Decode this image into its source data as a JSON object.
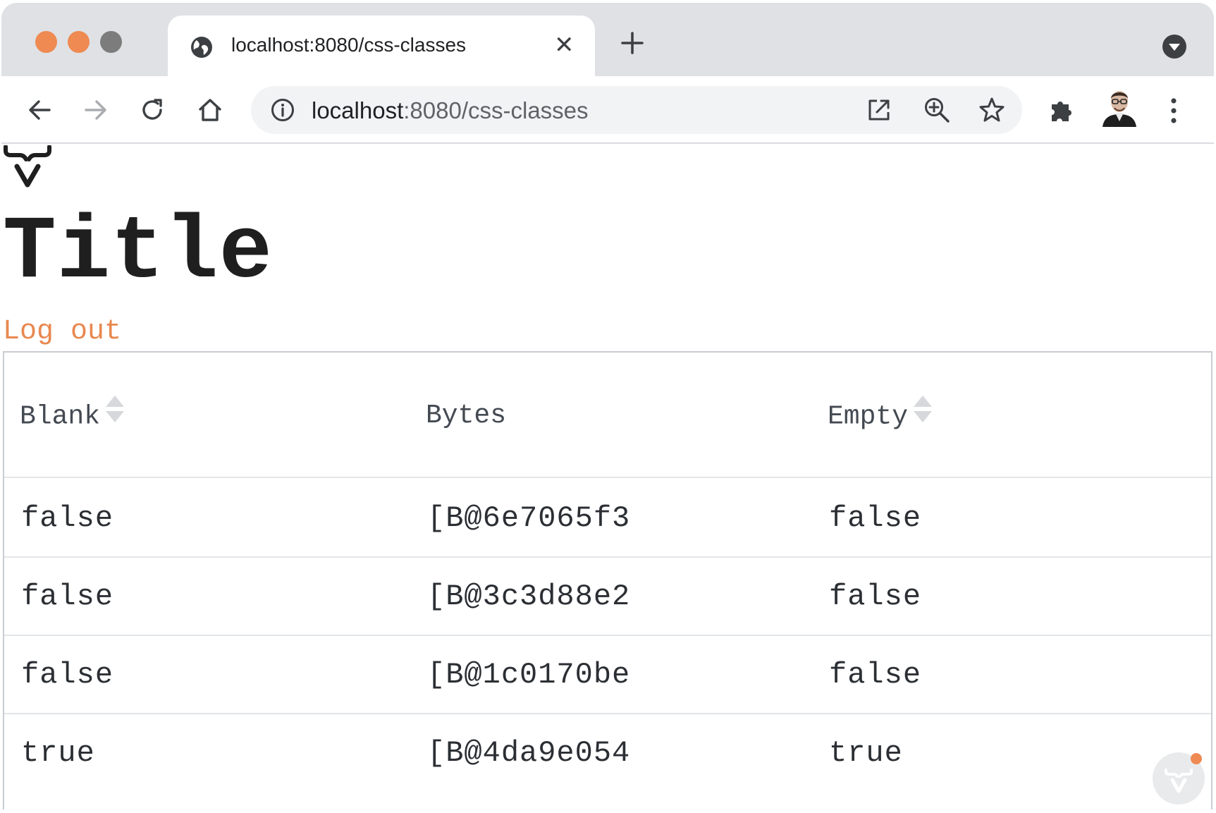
{
  "browser": {
    "tab": {
      "title": "localhost:8080/css-classes",
      "close_symbol": "✕"
    },
    "address": {
      "host": "localhost",
      "rest": ":8080/css-classes"
    },
    "colors": {
      "close_dot": "#ee8a52",
      "minimize_dot": "#ee8a52",
      "zoom_dot": "#7c7c7c",
      "tabstrip": "#dfe1e5"
    },
    "icons": [
      "globe-icon",
      "new-tab-icon",
      "tab-search-icon",
      "back-icon",
      "forward-icon",
      "reload-icon",
      "home-icon",
      "info-icon",
      "open-external-icon",
      "zoom-icon",
      "star-icon",
      "extensions-icon",
      "profile-avatar",
      "kebab-menu-icon"
    ]
  },
  "page": {
    "title": "Title",
    "logout_label": "Log out",
    "link_color": "#e8884f",
    "grid": {
      "headers": [
        {
          "label": "Blank",
          "sortable": true
        },
        {
          "label": "Bytes",
          "sortable": false
        },
        {
          "label": "Empty",
          "sortable": true
        }
      ],
      "rows": [
        {
          "blank": "false",
          "bytes": "[B@6e7065f3",
          "empty": "false"
        },
        {
          "blank": "false",
          "bytes": "[B@3c3d88e2",
          "empty": "false"
        },
        {
          "blank": "false",
          "bytes": "[B@1c0170be",
          "empty": "false"
        },
        {
          "blank": "true",
          "bytes": "[B@4da9e054",
          "empty": "true"
        }
      ]
    },
    "dev_badge_dot_color": "#ee8a52"
  }
}
